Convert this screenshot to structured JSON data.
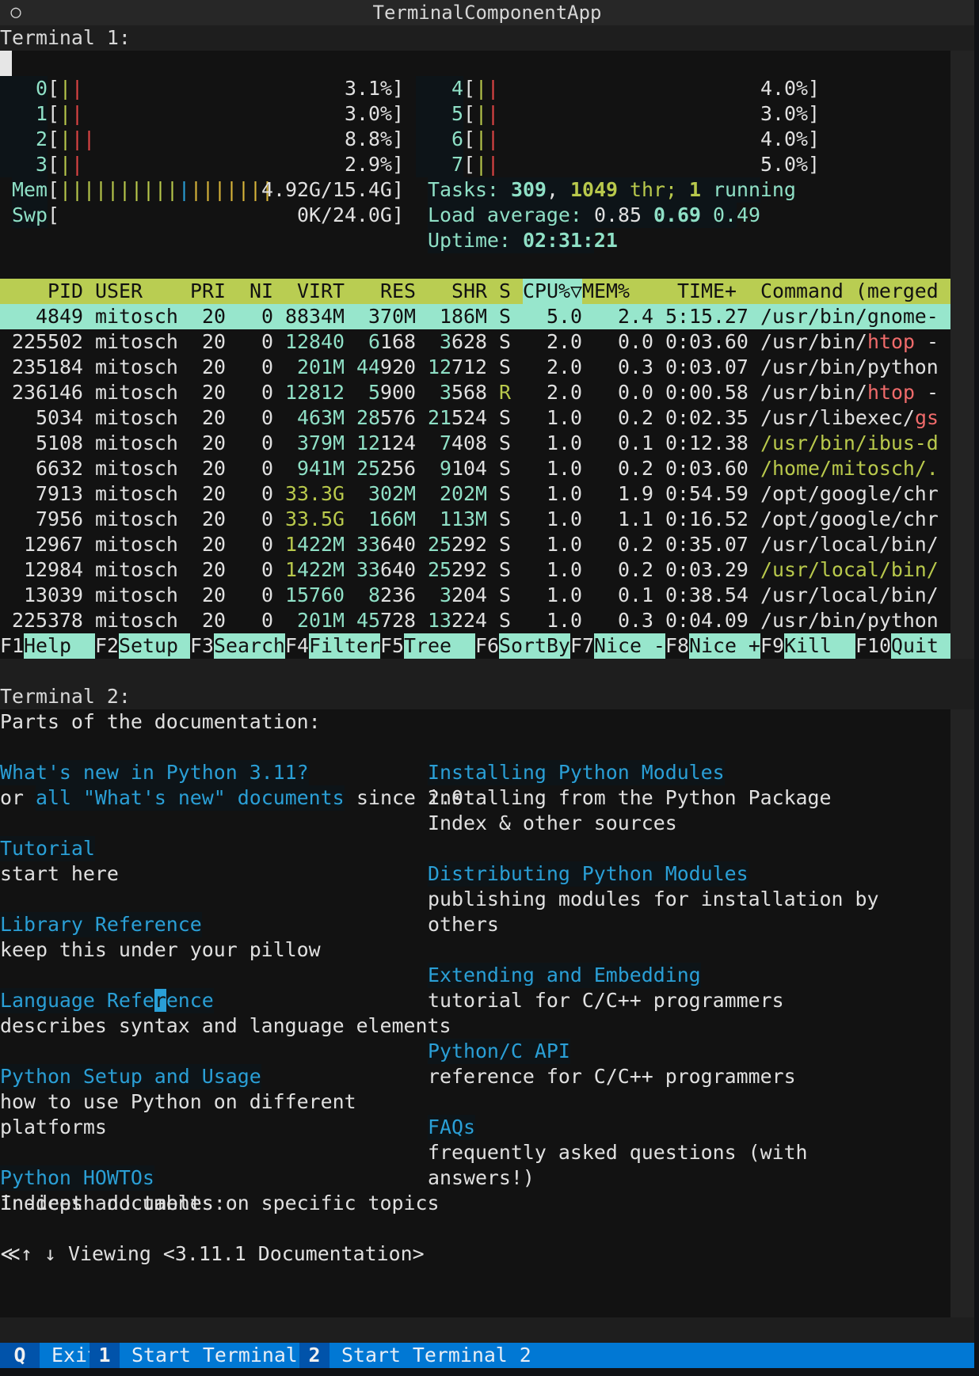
{
  "window": {
    "title": "TerminalComponentApp",
    "menu_icon": "○"
  },
  "terminal1": {
    "label": "Terminal 1:",
    "cpus_left": [
      {
        "id": "0",
        "bars": [
          "yel",
          "red"
        ],
        "pct": "3.1%"
      },
      {
        "id": "1",
        "bars": [
          "yel",
          "red"
        ],
        "pct": "3.0%"
      },
      {
        "id": "2",
        "bars": [
          "yel",
          "red",
          "red"
        ],
        "pct": "8.8%"
      },
      {
        "id": "3",
        "bars": [
          "yel",
          "red"
        ],
        "pct": "2.9%"
      }
    ],
    "cpus_right": [
      {
        "id": "4",
        "bars": [
          "yel",
          "red"
        ],
        "pct": "4.0%"
      },
      {
        "id": "5",
        "bars": [
          "yel",
          "red"
        ],
        "pct": "3.0%"
      },
      {
        "id": "6",
        "bars": [
          "yel",
          "red"
        ],
        "pct": "4.0%"
      },
      {
        "id": "7",
        "bars": [
          "yel",
          "red"
        ],
        "pct": "5.0%"
      }
    ],
    "mem": {
      "label": "Mem",
      "value": "4.92G/15.4G",
      "bars": 18,
      "blue_index": 10
    },
    "swp": {
      "label": "Swp",
      "value": "0K/24.0G"
    },
    "tasks": {
      "label": "Tasks: ",
      "count": "309",
      "sep": ", ",
      "threads": "1049",
      "thr_label": " thr; ",
      "running": "1",
      "running_label": " running"
    },
    "load": {
      "label": "Load average: ",
      "l1": "0.85",
      "l5": "0.69",
      "l15": "0.49"
    },
    "uptime": {
      "label": "Uptime: ",
      "value": "02:31:21"
    },
    "columns": [
      "PID",
      "USER",
      "PRI",
      "NI",
      "VIRT",
      "RES",
      "SHR",
      "S",
      "CPU%▽",
      "MEM%",
      "TIME+",
      "Command (merged"
    ],
    "sort_column": "CPU%▽",
    "processes": [
      {
        "pid": "4849",
        "user": "mitosch",
        "pri": "20",
        "ni": "0",
        "virt": "8834M",
        "res": "370M",
        "shr": "186M",
        "s": "S",
        "cpu": "5.0",
        "mem": "2.4",
        "time": "5:15.27",
        "cmd": [
          [
            "/usr/bin/gnome-",
            "n"
          ]
        ],
        "selected": true
      },
      {
        "pid": "225502",
        "user": "mitosch",
        "pri": "20",
        "ni": "0",
        "virt": "12840",
        "res": "6168",
        "shr": "3628",
        "s": "S",
        "cpu": "2.0",
        "mem": "0.0",
        "time": "0:03.60",
        "cmd": [
          [
            "/usr/bin/",
            "n"
          ],
          [
            "htop",
            "p"
          ],
          [
            " -",
            "n"
          ]
        ]
      },
      {
        "pid": "235184",
        "user": "mitosch",
        "pri": "20",
        "ni": "0",
        "virt": "201M",
        "res": "44920",
        "shr": "12712",
        "s": "S",
        "cpu": "2.0",
        "mem": "0.3",
        "time": "0:03.07",
        "cmd": [
          [
            "/usr/bin/python",
            "n"
          ]
        ]
      },
      {
        "pid": "236146",
        "user": "mitosch",
        "pri": "20",
        "ni": "0",
        "virt": "12812",
        "res": "5900",
        "shr": "3568",
        "s": "R",
        "cpu": "2.0",
        "mem": "0.0",
        "time": "0:00.58",
        "cmd": [
          [
            "/usr/bin/",
            "n"
          ],
          [
            "htop",
            "p"
          ],
          [
            " -",
            "n"
          ]
        ]
      },
      {
        "pid": "5034",
        "user": "mitosch",
        "pri": "20",
        "ni": "0",
        "virt": "463M",
        "res": "28576",
        "shr": "21524",
        "s": "S",
        "cpu": "1.0",
        "mem": "0.2",
        "time": "0:02.35",
        "cmd": [
          [
            "/usr/libexec/",
            "n"
          ],
          [
            "gs",
            "p"
          ]
        ]
      },
      {
        "pid": "5108",
        "user": "mitosch",
        "pri": "20",
        "ni": "0",
        "virt": "379M",
        "res": "12124",
        "shr": "7408",
        "s": "S",
        "cpu": "1.0",
        "mem": "0.1",
        "time": "0:12.38",
        "cmd": [
          [
            "/usr/bin/ibus-d",
            "y"
          ]
        ]
      },
      {
        "pid": "6632",
        "user": "mitosch",
        "pri": "20",
        "ni": "0",
        "virt": "941M",
        "res": "25256",
        "shr": "9104",
        "s": "S",
        "cpu": "1.0",
        "mem": "0.2",
        "time": "0:03.60",
        "cmd": [
          [
            "/home/mitosch/.",
            "y"
          ]
        ]
      },
      {
        "pid": "7913",
        "user": "mitosch",
        "pri": "20",
        "ni": "0",
        "virt": "33.3G",
        "res": "302M",
        "shr": "202M",
        "s": "S",
        "cpu": "1.0",
        "mem": "1.9",
        "time": "0:54.59",
        "cmd": [
          [
            "/opt/google/chr",
            "n"
          ]
        ]
      },
      {
        "pid": "7956",
        "user": "mitosch",
        "pri": "20",
        "ni": "0",
        "virt": "33.5G",
        "res": "166M",
        "shr": "113M",
        "s": "S",
        "cpu": "1.0",
        "mem": "1.1",
        "time": "0:16.52",
        "cmd": [
          [
            "/opt/google/chr",
            "n"
          ]
        ]
      },
      {
        "pid": "12967",
        "user": "mitosch",
        "pri": "20",
        "ni": "0",
        "virt": "1422M",
        "res": "33640",
        "shr": "25292",
        "s": "S",
        "cpu": "1.0",
        "mem": "0.2",
        "time": "0:35.07",
        "cmd": [
          [
            "/usr/local/bin/",
            "n"
          ]
        ]
      },
      {
        "pid": "12984",
        "user": "mitosch",
        "pri": "20",
        "ni": "0",
        "virt": "1422M",
        "res": "33640",
        "shr": "25292",
        "s": "S",
        "cpu": "1.0",
        "mem": "0.2",
        "time": "0:03.29",
        "cmd": [
          [
            "/usr/local/bin/",
            "y"
          ]
        ]
      },
      {
        "pid": "13039",
        "user": "mitosch",
        "pri": "20",
        "ni": "0",
        "virt": "15760",
        "res": "8236",
        "shr": "3204",
        "s": "S",
        "cpu": "1.0",
        "mem": "0.1",
        "time": "0:38.54",
        "cmd": [
          [
            "/usr/local/bin/",
            "n"
          ]
        ]
      },
      {
        "pid": "225378",
        "user": "mitosch",
        "pri": "20",
        "ni": "0",
        "virt": "201M",
        "res": "45728",
        "shr": "13224",
        "s": "S",
        "cpu": "1.0",
        "mem": "0.3",
        "time": "0:04.09",
        "cmd": [
          [
            "/usr/bin/python",
            "n"
          ]
        ]
      }
    ],
    "fkeys": [
      {
        "key": "F1",
        "label": "Help  "
      },
      {
        "key": "F2",
        "label": "Setup "
      },
      {
        "key": "F3",
        "label": "Search"
      },
      {
        "key": "F4",
        "label": "Filter"
      },
      {
        "key": "F5",
        "label": "Tree  "
      },
      {
        "key": "F6",
        "label": "SortBy"
      },
      {
        "key": "F7",
        "label": "Nice -"
      },
      {
        "key": "F8",
        "label": "Nice +"
      },
      {
        "key": "F9",
        "label": "Kill  "
      },
      {
        "key": "F10",
        "label": "Quit  "
      }
    ]
  },
  "terminal2": {
    "label": "Terminal 2:",
    "heading": "Parts of the documentation:",
    "left": [
      {
        "link": "What's new in Python 3.11?",
        "desc": [
          [
            [
              "or ",
              "t"
            ],
            [
              "all \"What's new\" documents",
              "l"
            ],
            [
              " since 2.0",
              "t"
            ]
          ]
        ]
      },
      {
        "link": "Tutorial",
        "desc": [
          [
            [
              "start here",
              "t"
            ]
          ]
        ]
      },
      {
        "link": "Library Reference",
        "desc": [
          [
            [
              "keep this under your pillow",
              "t"
            ]
          ]
        ]
      },
      {
        "link": "Language Reference",
        "desc": [
          [
            [
              "describes syntax and language elements",
              "t"
            ]
          ]
        ],
        "cursor_index": 13
      },
      {
        "link": "Python Setup and Usage",
        "desc": [
          [
            [
              "how to use Python on different",
              "t"
            ]
          ],
          [
            [
              "platforms",
              "t"
            ]
          ]
        ]
      },
      {
        "link": "Python HOWTOs",
        "desc": [
          [
            [
              "in-depth documents on specific topics",
              "t"
            ]
          ]
        ]
      }
    ],
    "right": [
      {
        "link": "Installing Python Modules",
        "desc": [
          "installing from the Python Package",
          "Index & other sources"
        ]
      },
      {
        "link": "Distributing Python Modules",
        "desc": [
          "publishing modules for installation by",
          "others"
        ]
      },
      {
        "link": "Extending and Embedding",
        "desc": [
          "tutorial for C/C++ programmers"
        ]
      },
      {
        "link": "Python/C API",
        "desc": [
          "reference for C/C++ programmers"
        ]
      },
      {
        "link": "FAQs",
        "desc": [
          "frequently asked questions (with",
          "answers!)"
        ]
      }
    ],
    "indices": "Indices and tables:",
    "status": "≪↑ ↓ Viewing <3.11.1 Documentation>"
  },
  "footer": [
    {
      "key": "Q",
      "label": "Exit"
    },
    {
      "key": "1",
      "label": "Start Terminal 1"
    },
    {
      "key": "2",
      "label": "Start Terminal 2"
    }
  ]
}
